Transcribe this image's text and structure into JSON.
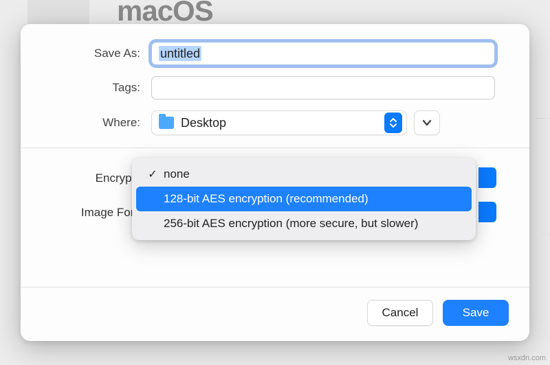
{
  "background": {
    "title": "macOS"
  },
  "saveAs": {
    "label": "Save As:",
    "value": "untitled"
  },
  "tags": {
    "label": "Tags:",
    "value": ""
  },
  "where": {
    "label": "Where:",
    "value": "Desktop"
  },
  "encryption": {
    "label": "Encryption",
    "menu": {
      "options": [
        {
          "label": "none",
          "checked": true,
          "highlighted": false
        },
        {
          "label": "128-bit AES encryption (recommended)",
          "checked": false,
          "highlighted": true
        },
        {
          "label": "256-bit AES encryption (more secure, but slower)",
          "checked": false,
          "highlighted": false
        }
      ]
    }
  },
  "imageFormat": {
    "label": "Image Forma"
  },
  "footer": {
    "cancel": "Cancel",
    "save": "Save"
  },
  "watermark": "wsxdn.com"
}
